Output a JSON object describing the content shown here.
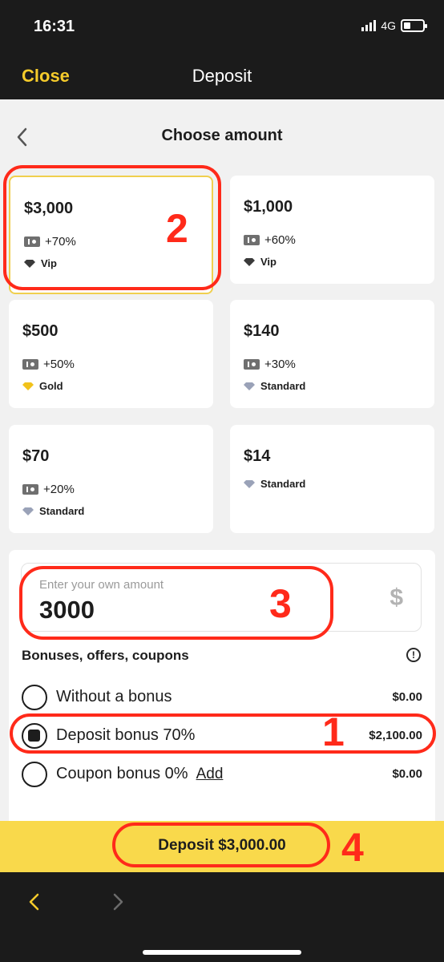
{
  "status": {
    "time": "16:31",
    "network": "4G",
    "battery_level": 0.35
  },
  "nav": {
    "close_label": "Close",
    "title": "Deposit"
  },
  "page_title": "Choose amount",
  "cards": [
    {
      "amount": "$3,000",
      "bonus": "+70%",
      "tier": "Vip",
      "tier_color": "#3a3a3a"
    },
    {
      "amount": "$1,000",
      "bonus": "+60%",
      "tier": "Vip",
      "tier_color": "#3a3a3a"
    },
    {
      "amount": "$500",
      "bonus": "+50%",
      "tier": "Gold",
      "tier_color": "#f1c21b"
    },
    {
      "amount": "$140",
      "bonus": "+30%",
      "tier": "Standard",
      "tier_color": "#9aa2b8"
    },
    {
      "amount": "$70",
      "bonus": "+20%",
      "tier": "Standard",
      "tier_color": "#9aa2b8"
    },
    {
      "amount": "$14",
      "bonus": "",
      "tier": "Standard",
      "tier_color": "#9aa2b8"
    }
  ],
  "amount_input": {
    "placeholder": "Enter your own amount",
    "value": "3000",
    "currency": "$"
  },
  "bonus_section": {
    "heading": "Bonuses, offers, coupons",
    "info_icon": "!",
    "options": [
      {
        "label": "Without a bonus",
        "link": "",
        "amount": "$0.00",
        "selected": false
      },
      {
        "label": "Deposit bonus 70%",
        "link": "",
        "amount": "$2,100.00",
        "selected": true
      },
      {
        "label": "Coupon bonus 0%",
        "link": "Add",
        "amount": "$0.00",
        "selected": false
      }
    ]
  },
  "deposit_button_label": "Deposit $3,000.00",
  "annotations": [
    "2",
    "3",
    "1",
    "4"
  ],
  "colors": {
    "accent": "#f5cb2b",
    "annotation": "#ff2a1a",
    "deposit_bar": "#f9d94b"
  }
}
